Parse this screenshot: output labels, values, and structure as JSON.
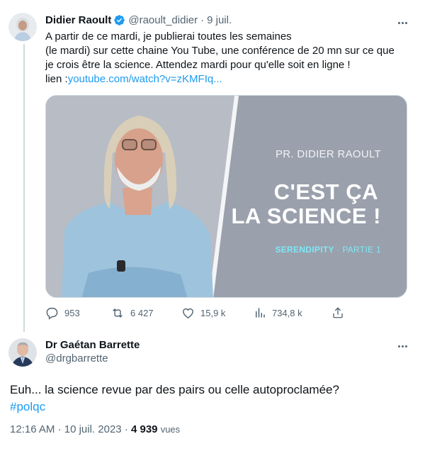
{
  "tweet1": {
    "author_name": "Didier Raoult",
    "handle": "@raoult_didier",
    "separator": "·",
    "date": "9 juil.",
    "text_lines": [
      "A partir de ce mardi, je publierai toutes les semaines",
      "(le mardi) sur cette chaine You Tube, une conférence de 20 mn sur ce que",
      "je crois être la science. Attendez mardi pour qu'elle soit en ligne !"
    ],
    "link_prefix": "lien :",
    "link_text": "youtube.com/watch?v=zKMFIq...",
    "media": {
      "kicker": "PR. DIDIER RAOULT",
      "title_line1": "C'EST ÇA",
      "title_line2": "LA SCIENCE !",
      "series": "SERENDIPITY",
      "part": " · PARTIE 1"
    },
    "actions": {
      "replies": "953",
      "retweets": "6 427",
      "likes": "15,9 k",
      "views": "734,8 k"
    },
    "colors": {
      "verified": "#1d9bf0",
      "link": "#1d9bf0",
      "media_bg": "#9aa0ac"
    }
  },
  "tweet2": {
    "author_name": "Dr Gaétan Barrette",
    "handle": "@drgbarrette",
    "text_line1": "Euh... la science revue par des pairs ou celle autoproclamée?",
    "hashtag": "#polqc",
    "time": "12:16 AM",
    "separator": "·",
    "date": "10 juil. 2023",
    "views_count": "4 939",
    "views_label": "vues"
  }
}
